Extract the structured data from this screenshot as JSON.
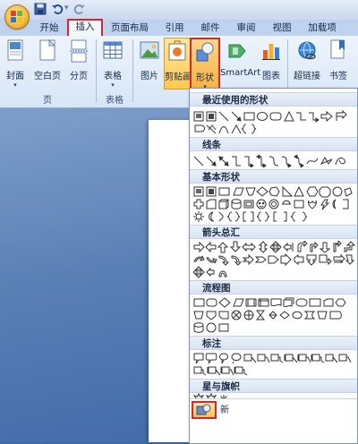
{
  "tabs": [
    "开始",
    "插入",
    "页面布局",
    "引用",
    "邮件",
    "审阅",
    "视图",
    "加载项"
  ],
  "active_tab": "插入",
  "ribbon": {
    "cover": "封面",
    "blank_page": "空白页",
    "page_break": "分页",
    "table": "表格",
    "picture": "图片",
    "clip_art": "剪贴画",
    "shapes": "形状",
    "smartart": "SmartArt",
    "chart": "图表",
    "hyperlink": "超链接",
    "bookmark": "书签",
    "group_pages": "页",
    "group_tables": "表格"
  },
  "gallery": {
    "recent": "最近使用的形状",
    "lines": "线条",
    "basic": "基本形状",
    "arrows": "箭头总汇",
    "flowchart": "流程图",
    "callouts": "标注",
    "stars": "星与旗帜",
    "more_text": "新"
  },
  "colors": {
    "highlight_border": "#d32630",
    "ribbon_bg": "#dbe7f7",
    "page_bg": "#ffffff",
    "doc_bg": "#4e75b0"
  }
}
